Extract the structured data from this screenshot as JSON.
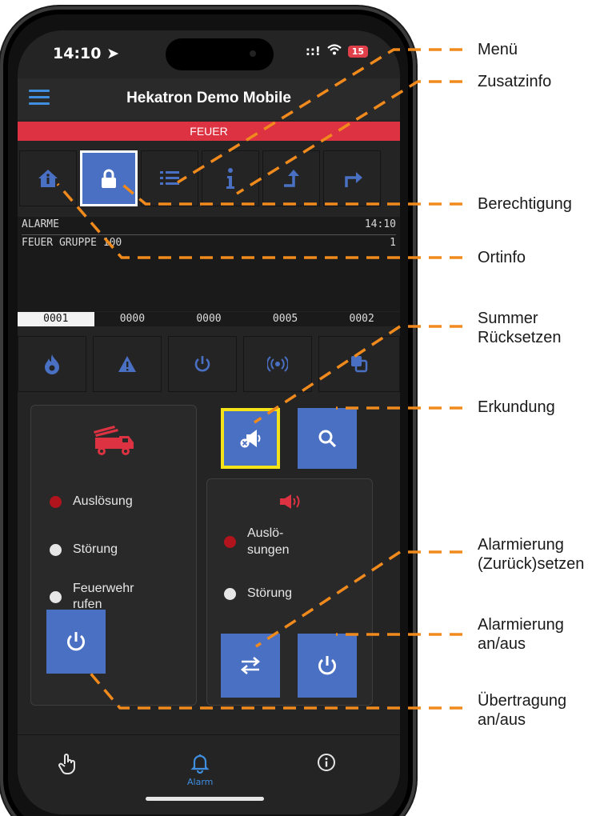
{
  "status": {
    "time": "14:10",
    "signal": "::!",
    "battery": "15"
  },
  "app": {
    "title": "Hekatron Demo Mobile",
    "banner": "FEUER"
  },
  "tabs": [
    {
      "icon": "home-info-icon"
    },
    {
      "icon": "lock-icon",
      "selected": true
    },
    {
      "icon": "list-icon"
    },
    {
      "icon": "info-icon"
    },
    {
      "icon": "arrow-up-left-icon"
    },
    {
      "icon": "arrow-up-right-icon"
    }
  ],
  "messages": {
    "header_label": "ALARME",
    "header_time": "14:10",
    "row1_text": "FEUER GRUPPE 100",
    "row1_count": "1"
  },
  "counters": [
    "0001",
    "0000",
    "0000",
    "0005",
    "0002"
  ],
  "status_icons": [
    "fire-icon",
    "warning-icon",
    "power-icon",
    "broadcast-icon",
    "layers-icon"
  ],
  "left_panel": {
    "icon": "fire-truck-icon",
    "items": [
      "Auslösung",
      "Störung",
      "Feuerwehr\nrufen"
    ]
  },
  "right_panel": {
    "icon": "speaker-icon",
    "items": [
      "Auslö-\nsungen",
      "Störung"
    ]
  },
  "nav": {
    "alarm_label": "Alarm"
  },
  "annotations": {
    "menu": "Menü",
    "zusatzinfo": "Zusatzinfo",
    "berechtigung": "Berechtigung",
    "ortinfo": "Ortinfo",
    "summer": "Summer\nRücksetzen",
    "erkundung": "Erkundung",
    "alarm_reset": "Alarmierung\n(Zurück)setzen",
    "alarm_onoff": "Alarmierung\nan/aus",
    "uebertragung": "Übertragung\nan/aus"
  },
  "colors": {
    "accent_blue": "#4a70c4",
    "alarm_red": "#dc3242",
    "annotation_orange": "#f08a1c",
    "highlight_yellow": "#f5e31a"
  }
}
